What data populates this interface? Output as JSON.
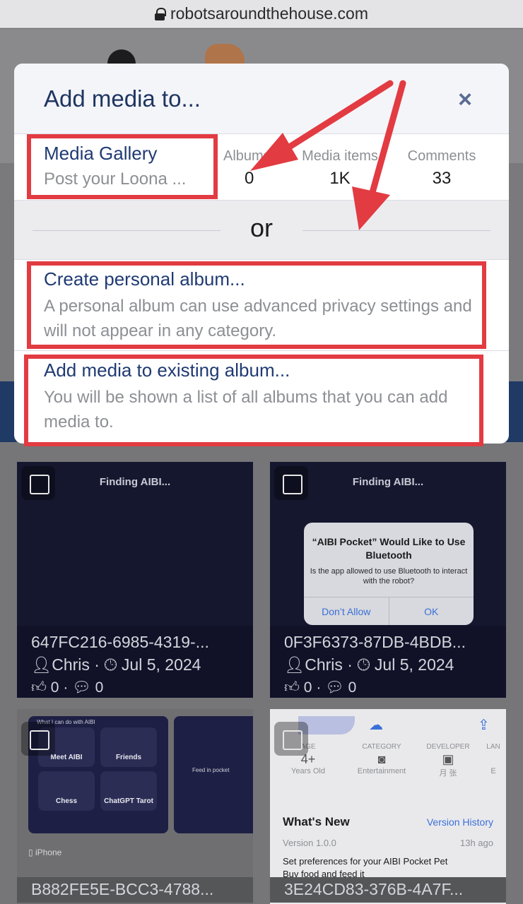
{
  "browser": {
    "url": "robotsaroundthehouse.com"
  },
  "modal": {
    "title": "Add media to...",
    "close_symbol": "×",
    "gallery": {
      "name": "Media Gallery",
      "description": "Post your Loona ...",
      "stats": [
        {
          "label": "Albums",
          "value": "0"
        },
        {
          "label": "Media items",
          "value": "1K"
        },
        {
          "label": "Comments",
          "value": "33"
        }
      ]
    },
    "or_label": "or",
    "options": [
      {
        "title": "Create personal album...",
        "description": "A personal album can use advanced privacy settings and will not appear in any category."
      },
      {
        "title": "Add media to existing album...",
        "description": "You will be shown a list of all albums that you can add media to."
      }
    ]
  },
  "highlight_color": "#e23b42",
  "media": [
    {
      "screen_title": "Finding AIBI...",
      "name": "647FC216-6985-4319-...",
      "author": "Chris",
      "date": "Jul 5, 2024",
      "likes": "0",
      "comments": "0"
    },
    {
      "screen_title": "Finding AIBI...",
      "name": "0F3F6373-87DB-4BDB...",
      "author": "Chris",
      "date": "Jul 5, 2024",
      "likes": "0",
      "comments": "0",
      "alert": {
        "title": "“AIBI Pocket” Would Like to Use Bluetooth",
        "message": "Is the app allowed to use Bluetooth to interact with the robot?",
        "buttons": [
          "Don’t Allow",
          "OK"
        ]
      }
    },
    {
      "header": "What I can do with AIBI",
      "tiles": [
        "Meet AIBI",
        "Friends",
        "Chess",
        "ChatGPT Tarot"
      ],
      "side_label": "Feed in pocket",
      "device": "iPhone",
      "name": "B882FE5E-BCC3-4788..."
    },
    {
      "app_store": {
        "columns": [
          {
            "category": "AGE",
            "value": "4+",
            "sub": "Years Old"
          },
          {
            "category": "CATEGORY",
            "value": "",
            "sub": "Entertainment"
          },
          {
            "category": "DEVELOPER",
            "value": "",
            "sub": "月 张"
          },
          {
            "category": "LAN",
            "value": "",
            "sub": "E"
          }
        ],
        "whats_new": "What's New",
        "version_history": "Version History",
        "version": "Version 1.0.0",
        "time_ago": "13h ago",
        "notes": [
          "Set preferences for your AIBI Pocket Pet",
          "Buy food and feed it"
        ]
      },
      "name": "3E24CD83-376B-4A7F..."
    }
  ]
}
